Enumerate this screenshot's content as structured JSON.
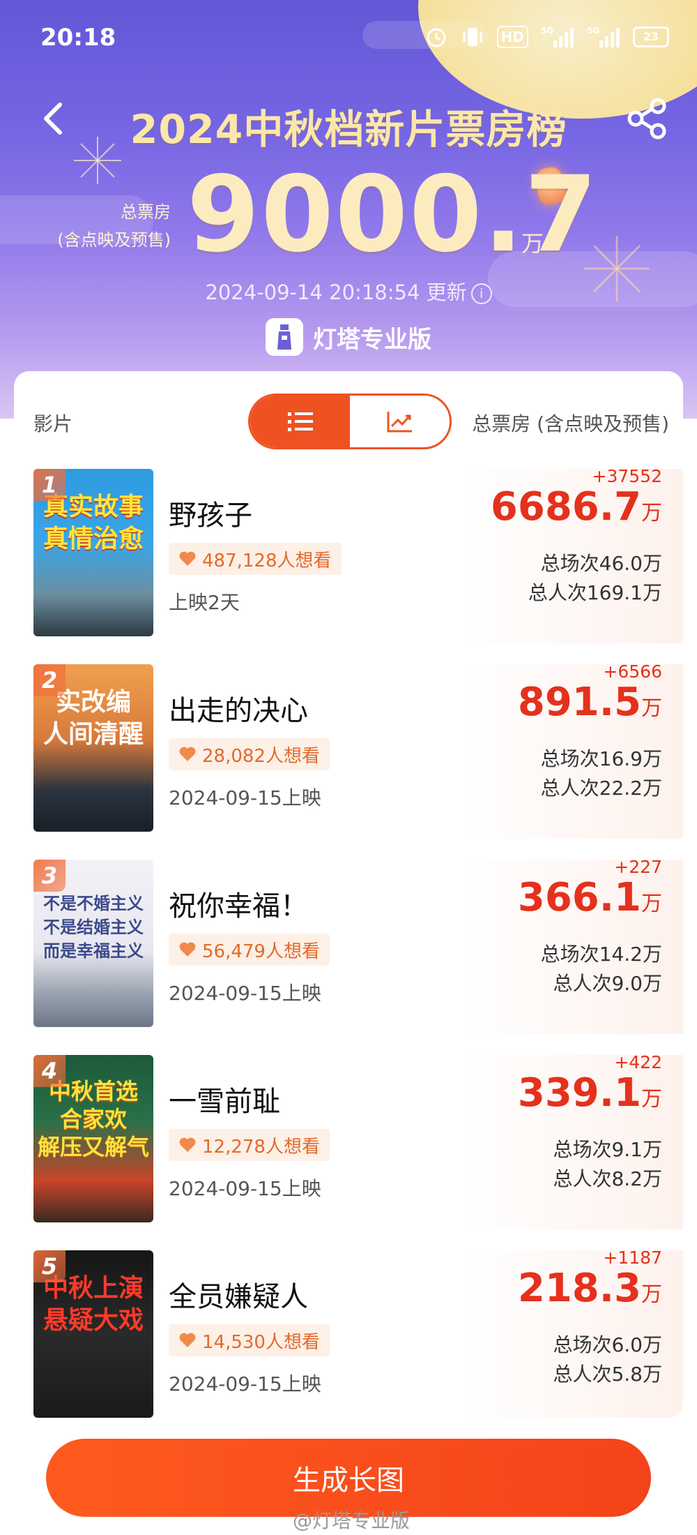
{
  "status_bar": {
    "time": "20:18",
    "hd": "HD",
    "net1": "5G",
    "net2": "5G",
    "battery": "23"
  },
  "header": {
    "title": "2024中秋档新片票房榜",
    "total_label_line1": "总票房",
    "total_label_line2": "(含点映及预售)",
    "total_value": "9000.7",
    "total_unit": "万",
    "updated": "2024-09-14 20:18:54 更新",
    "brand": "灯塔专业版"
  },
  "table_header": {
    "film": "影片",
    "total": "总票房 (含点映及预售)"
  },
  "movies": [
    {
      "rank": "1",
      "name": "野孩子",
      "want": "487,128人想看",
      "release": "上映2天",
      "delta": "+37552",
      "box": "6686.7",
      "unit": "万",
      "sessions": "总场次46.0万",
      "people": "总人次169.1万",
      "poster_text": "真实故事\n真情治愈"
    },
    {
      "rank": "2",
      "name": "出走的决心",
      "want": "28,082人想看",
      "release": "2024-09-15上映",
      "delta": "+6566",
      "box": "891.5",
      "unit": "万",
      "sessions": "总场次16.9万",
      "people": "总人次22.2万",
      "poster_text": "实改编\n人间清醒"
    },
    {
      "rank": "3",
      "name": "祝你幸福！",
      "want": "56,479人想看",
      "release": "2024-09-15上映",
      "delta": "+227",
      "box": "366.1",
      "unit": "万",
      "sessions": "总场次14.2万",
      "people": "总人次9.0万",
      "poster_text": "不是不婚主义\n不是结婚主义\n而是幸福主义"
    },
    {
      "rank": "4",
      "name": "一雪前耻",
      "want": "12,278人想看",
      "release": "2024-09-15上映",
      "delta": "+422",
      "box": "339.1",
      "unit": "万",
      "sessions": "总场次9.1万",
      "people": "总人次8.2万",
      "poster_text": "中秋首选\n合家欢\n解压又解气"
    },
    {
      "rank": "5",
      "name": "全员嫌疑人",
      "want": "14,530人想看",
      "release": "2024-09-15上映",
      "delta": "+1187",
      "box": "218.3",
      "unit": "万",
      "sessions": "总场次6.0万",
      "people": "总人次5.8万",
      "poster_text": "中秋上演\n悬疑大戏"
    }
  ],
  "bottom": {
    "button": "生成长图",
    "watermark": "@灯塔专业版"
  }
}
